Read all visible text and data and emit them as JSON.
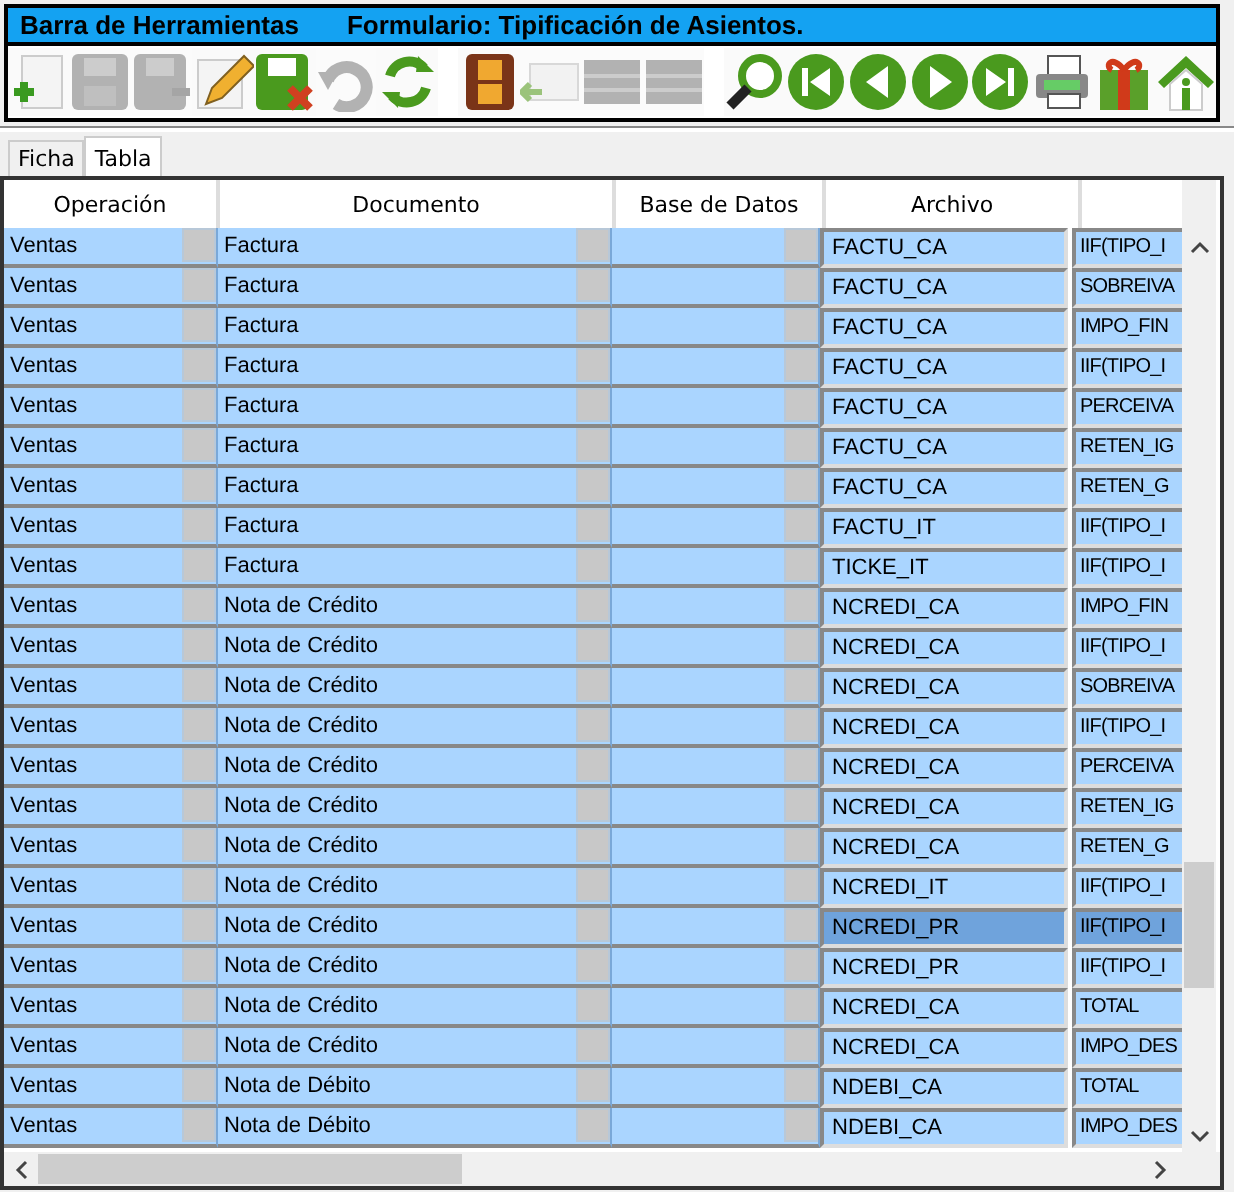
{
  "title_bar": {
    "app": "Barra de Herramientas",
    "form": "Formulario: Tipificación de Asientos."
  },
  "toolbar": [
    {
      "kind": "new",
      "disabled": false
    },
    {
      "kind": "save",
      "disabled": true
    },
    {
      "kind": "save-as",
      "disabled": true
    },
    {
      "kind": "edit",
      "disabled": false
    },
    {
      "kind": "save-cancel",
      "disabled": false
    },
    {
      "kind": "undo",
      "disabled": true
    },
    {
      "kind": "refresh",
      "disabled": false
    },
    {
      "kind": "film",
      "disabled": false
    },
    {
      "kind": "mail",
      "disabled": true
    },
    {
      "kind": "grid",
      "disabled": true
    },
    {
      "kind": "grid",
      "disabled": true
    },
    {
      "kind": "search",
      "disabled": false
    },
    {
      "kind": "first",
      "disabled": false
    },
    {
      "kind": "prev",
      "disabled": false
    },
    {
      "kind": "next",
      "disabled": false
    },
    {
      "kind": "last",
      "disabled": false
    },
    {
      "kind": "print",
      "disabled": false
    },
    {
      "kind": "gift",
      "disabled": false
    },
    {
      "kind": "home",
      "disabled": false
    }
  ],
  "tabs": [
    {
      "label": "Ficha",
      "selected": false
    },
    {
      "label": "Tabla",
      "selected": true
    }
  ],
  "table": {
    "columns": [
      "Operación",
      "Documento",
      "Base de Datos",
      "Archivo"
    ],
    "rows": [
      {
        "operacion": "Ventas",
        "documento": "Factura",
        "archivo": "FACTU_CA",
        "column_5": "IIF(TIPO_I",
        "selected": false
      },
      {
        "operacion": "Ventas",
        "documento": "Factura",
        "archivo": "FACTU_CA",
        "column_5": "SOBREIVA",
        "selected": false
      },
      {
        "operacion": "Ventas",
        "documento": "Factura",
        "archivo": "FACTU_CA",
        "column_5": "IMPO_FIN",
        "selected": false
      },
      {
        "operacion": "Ventas",
        "documento": "Factura",
        "archivo": "FACTU_CA",
        "column_5": "IIF(TIPO_I",
        "selected": false
      },
      {
        "operacion": "Ventas",
        "documento": "Factura",
        "archivo": "FACTU_CA",
        "column_5": "PERCEIVA",
        "selected": false
      },
      {
        "operacion": "Ventas",
        "documento": "Factura",
        "archivo": "FACTU_CA",
        "column_5": "RETEN_IG",
        "selected": false
      },
      {
        "operacion": "Ventas",
        "documento": "Factura",
        "archivo": "FACTU_CA",
        "column_5": "RETEN_G",
        "selected": false
      },
      {
        "operacion": "Ventas",
        "documento": "Factura",
        "archivo": "FACTU_IT",
        "column_5": "IIF(TIPO_I",
        "selected": false
      },
      {
        "operacion": "Ventas",
        "documento": "Factura",
        "archivo": "TICKE_IT",
        "column_5": "IIF(TIPO_I",
        "selected": false
      },
      {
        "operacion": "Ventas",
        "documento": "Nota de Crédito",
        "archivo": "NCREDI_CA",
        "column_5": "IMPO_FIN",
        "selected": false
      },
      {
        "operacion": "Ventas",
        "documento": "Nota de Crédito",
        "archivo": "NCREDI_CA",
        "column_5": "IIF(TIPO_I",
        "selected": false
      },
      {
        "operacion": "Ventas",
        "documento": "Nota de Crédito",
        "archivo": "NCREDI_CA",
        "column_5": "SOBREIVA",
        "selected": false
      },
      {
        "operacion": "Ventas",
        "documento": "Nota de Crédito",
        "archivo": "NCREDI_CA",
        "column_5": "IIF(TIPO_I",
        "selected": false
      },
      {
        "operacion": "Ventas",
        "documento": "Nota de Crédito",
        "archivo": "NCREDI_CA",
        "column_5": "PERCEIVA",
        "selected": false
      },
      {
        "operacion": "Ventas",
        "documento": "Nota de Crédito",
        "archivo": "NCREDI_CA",
        "column_5": "RETEN_IG",
        "selected": false
      },
      {
        "operacion": "Ventas",
        "documento": "Nota de Crédito",
        "archivo": "NCREDI_CA",
        "column_5": "RETEN_G",
        "selected": false
      },
      {
        "operacion": "Ventas",
        "documento": "Nota de Crédito",
        "archivo": "NCREDI_IT",
        "column_5": "IIF(TIPO_I",
        "selected": false
      },
      {
        "operacion": "Ventas",
        "documento": "Nota de Crédito",
        "archivo": "NCREDI_PR",
        "column_5": "IIF(TIPO_I",
        "selected": true
      },
      {
        "operacion": "Ventas",
        "documento": "Nota de Crédito",
        "archivo": "NCREDI_PR",
        "column_5": "IIF(TIPO_I",
        "selected": false
      },
      {
        "operacion": "Ventas",
        "documento": "Nota de Crédito",
        "archivo": "NCREDI_CA",
        "column_5": "TOTAL",
        "selected": false
      },
      {
        "operacion": "Ventas",
        "documento": "Nota de Crédito",
        "archivo": "NCREDI_CA",
        "column_5": "IMPO_DES",
        "selected": false
      },
      {
        "operacion": "Ventas",
        "documento": "Nota de Débito",
        "archivo": "NDEBI_CA",
        "column_5": "TOTAL",
        "selected": false
      },
      {
        "operacion": "Ventas",
        "documento": "Nota de Débito",
        "archivo": "NDEBI_CA",
        "column_5": "IMPO_DES",
        "selected": false
      }
    ]
  }
}
